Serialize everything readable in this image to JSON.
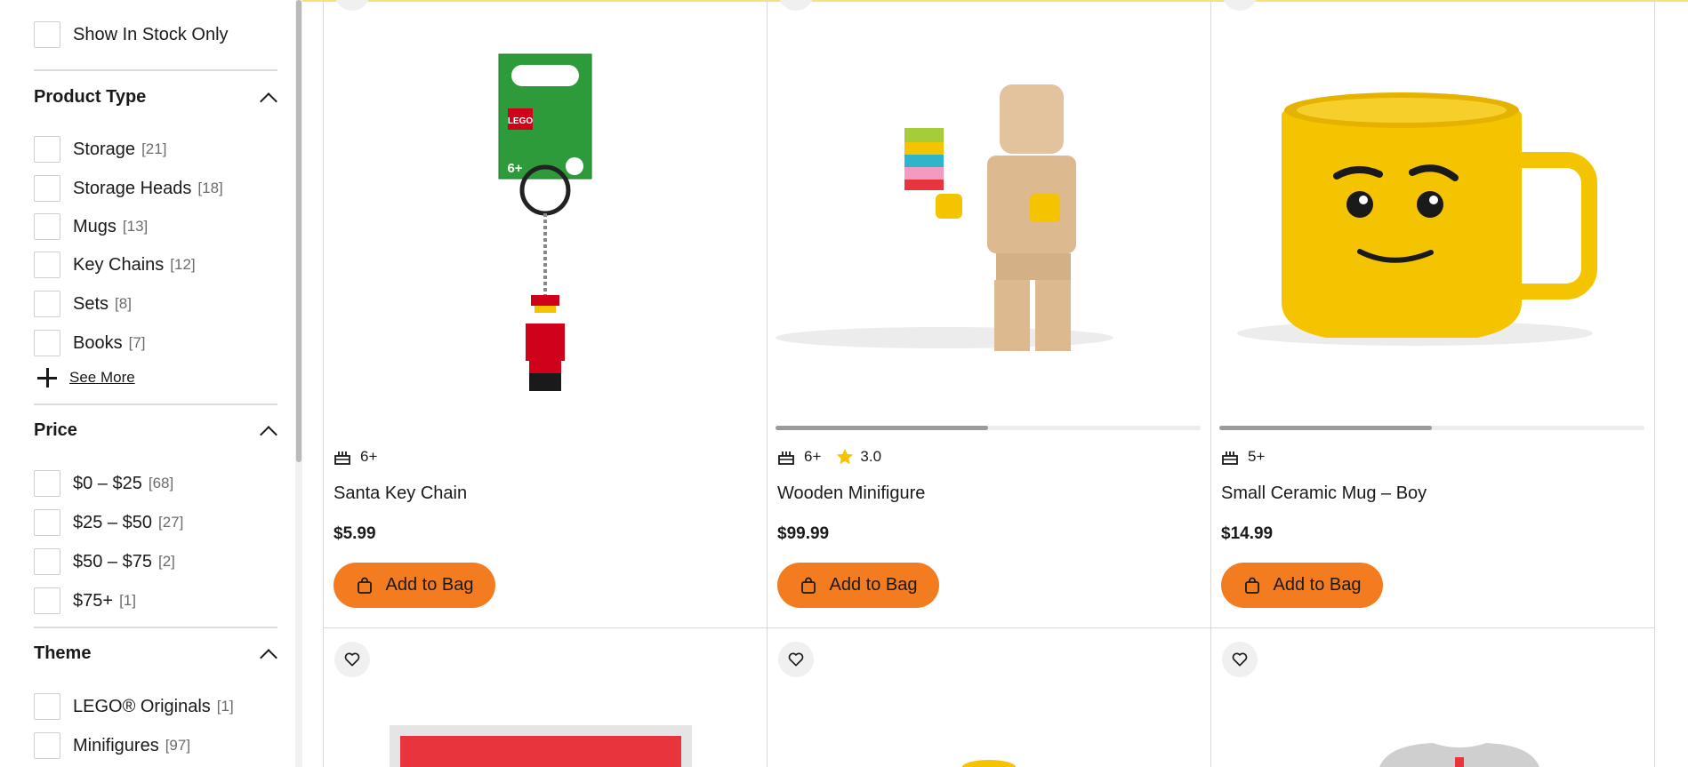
{
  "sidebar": {
    "in_stock_label": "Show In Stock Only",
    "product_type": {
      "title": "Product Type",
      "items": [
        {
          "label": "Storage",
          "count": "[21]"
        },
        {
          "label": "Storage Heads",
          "count": "[18]"
        },
        {
          "label": "Mugs",
          "count": "[13]"
        },
        {
          "label": "Key Chains",
          "count": "[12]"
        },
        {
          "label": "Sets",
          "count": "[8]"
        },
        {
          "label": "Books",
          "count": "[7]"
        }
      ],
      "see_more": "See More"
    },
    "price": {
      "title": "Price",
      "items": [
        {
          "label": "$0 – $25",
          "count": "[68]"
        },
        {
          "label": "$25 – $50",
          "count": "[27]"
        },
        {
          "label": "$50 – $75",
          "count": "[2]"
        },
        {
          "label": "$75+",
          "count": "[1]"
        }
      ]
    },
    "theme": {
      "title": "Theme",
      "items": [
        {
          "label": "LEGO® Originals",
          "count": "[1]"
        },
        {
          "label": "Minifigures",
          "count": "[97]"
        }
      ]
    }
  },
  "products": [
    {
      "name": "Santa Key Chain",
      "price": "$5.99",
      "age": "6+",
      "rating": null,
      "add_label": "Add to Bag",
      "image_progress": null
    },
    {
      "name": "Wooden Minifigure",
      "price": "$99.99",
      "age": "6+",
      "rating": "3.0",
      "add_label": "Add to Bag",
      "image_progress": 0.5
    },
    {
      "name": "Small Ceramic Mug – Boy",
      "price": "$14.99",
      "age": "5+",
      "rating": null,
      "add_label": "Add to Bag",
      "image_progress": 0.5
    }
  ],
  "colors": {
    "accent_orange": "#f47c20",
    "star_yellow": "#f5c400",
    "top_border_yellow": "#f7e27a"
  },
  "icons": [
    "cake-icon",
    "star-icon",
    "bag-icon",
    "heart-icon",
    "chevron-up-icon",
    "plus-icon"
  ]
}
